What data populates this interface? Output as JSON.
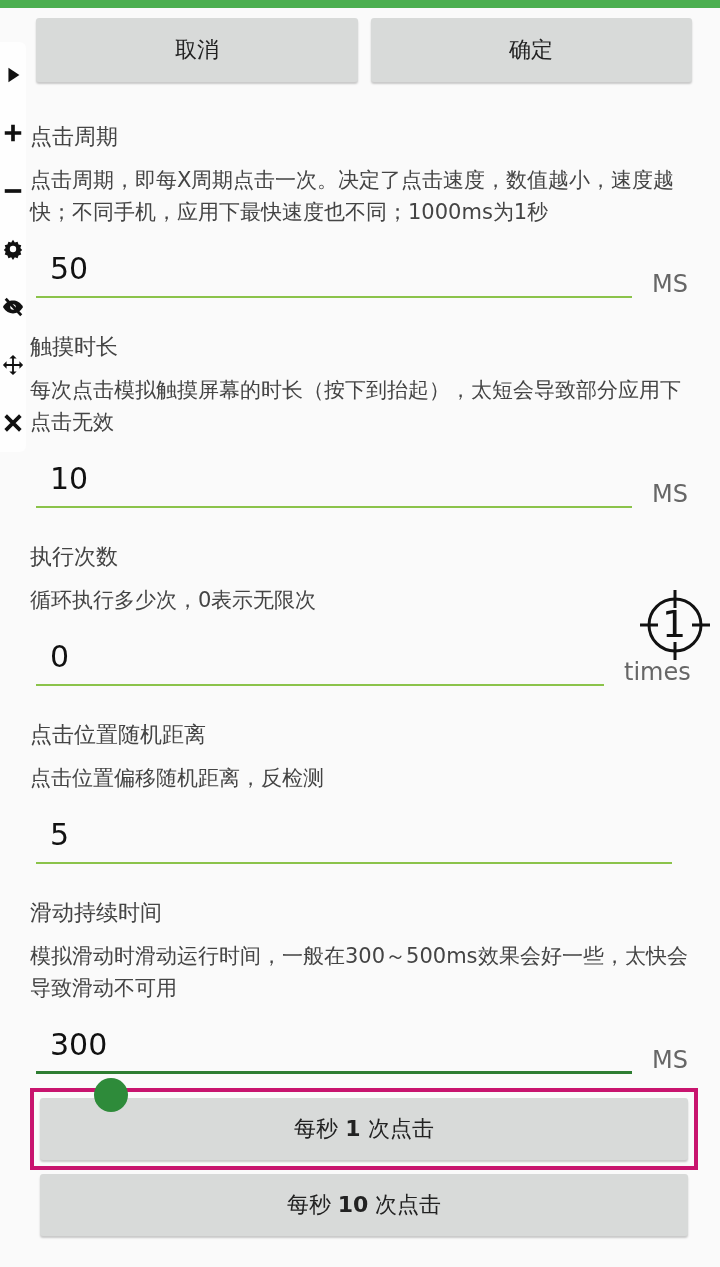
{
  "dialog_buttons": [
    "取消",
    "确定"
  ],
  "settings": [
    {
      "title": "点击周期",
      "description": "点击周期，即每X周期点击一次。决定了点击速度，数值越小，速度越快；不同手机，应用下最快速度也不同；1000ms为1秒",
      "value": "50",
      "unit": "MS",
      "focused": false
    },
    {
      "title": "触摸时长",
      "description": "每次点击模拟触摸屏幕的时长（按下到抬起），太短会导致部分应用下点击无效",
      "value": "10",
      "unit": "MS",
      "focused": false
    },
    {
      "title": "执行次数",
      "description": "循环执行多少次，0表示无限次",
      "value": "0",
      "unit": "times",
      "focused": false
    },
    {
      "title": "点击位置随机距离",
      "description": "点击位置偏移随机距离，反检测",
      "value": "5",
      "focused": false
    },
    {
      "title": "滑动持续时间",
      "description": "模拟滑动时滑动运行时间，一般在300～500ms效果会好一些，太快会导致滑动不可用",
      "value": "300",
      "unit": "MS",
      "focused": true
    }
  ],
  "presets": [
    {
      "label": "每秒 **1** 次点击",
      "highlighted": true
    },
    {
      "label": "每秒 **10** 次点击",
      "highlighted": false
    }
  ],
  "crosshair": {
    "label": "1"
  }
}
